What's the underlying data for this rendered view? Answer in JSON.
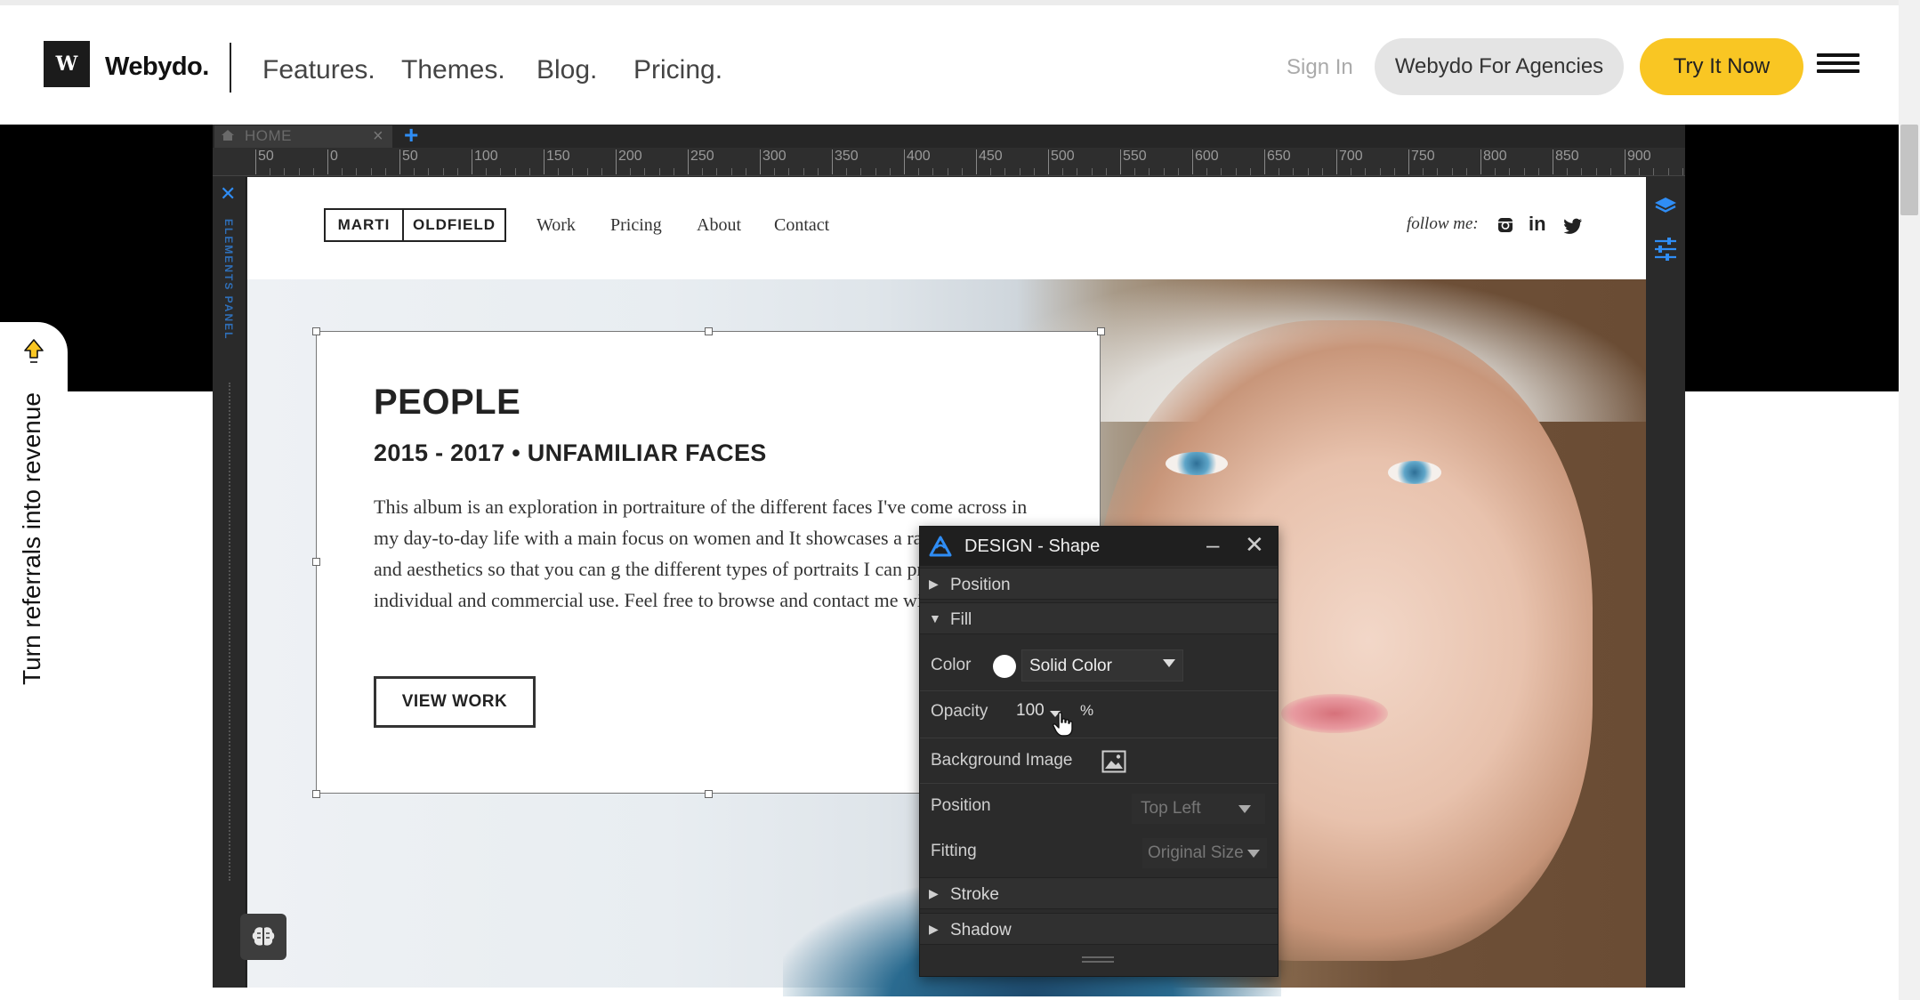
{
  "header": {
    "logo_mark": "W",
    "logo_text": "Webydo.",
    "nav": [
      "Features.",
      "Themes.",
      "Blog.",
      "Pricing."
    ],
    "sign_in": "Sign In",
    "agencies_button": "Webydo For Agencies",
    "try_button": "Try It Now",
    "accent_color": "#f9c623"
  },
  "referral_tab": {
    "text": "Turn referrals into revenue"
  },
  "editor": {
    "page_tab": "HOME",
    "ruler_labels": [
      "50",
      "0",
      "50",
      "100",
      "150",
      "200",
      "250",
      "300",
      "350",
      "400",
      "450",
      "500",
      "550",
      "600",
      "650",
      "700",
      "750",
      "800",
      "850",
      "900"
    ],
    "elements_panel_label": "ELEMENTS PANEL",
    "accent_color": "#2f8df5"
  },
  "site": {
    "logo_first": "MARTI",
    "logo_last": "OLDFIELD",
    "nav": [
      "Work",
      "Pricing",
      "About",
      "Contact"
    ],
    "follow_label": "follow me:",
    "social_icons": [
      "instagram-icon",
      "linkedin-icon",
      "twitter-icon"
    ],
    "linkedin_glyph": "in",
    "content": {
      "title": "PEOPLE",
      "subtitle": "2015 - 2017  •  UNFAMILIAR FACES",
      "body": "This album is an exploration in portraiture of the different faces I've come across in my day-to-day life with a main focus on women and It showcases a range of moods and aesthetics so that you can g the different types of portraits I can produce for individual and commercial use. Feel free to browse and contact me with quest",
      "button": "VIEW WORK"
    }
  },
  "design_panel": {
    "title": "DESIGN - Shape",
    "sections": {
      "position": "Position",
      "fill": "Fill",
      "stroke": "Stroke",
      "shadow": "Shadow"
    },
    "fields": {
      "color_label": "Color",
      "color_value": "Solid Color",
      "swatch_color": "#ffffff",
      "opacity_label": "Opacity",
      "opacity_value": "100",
      "opacity_unit": "%",
      "bg_image_label": "Background Image",
      "position_label": "Position",
      "position_value": "Top Left",
      "fitting_label": "Fitting",
      "fitting_value": "Original Size"
    }
  }
}
